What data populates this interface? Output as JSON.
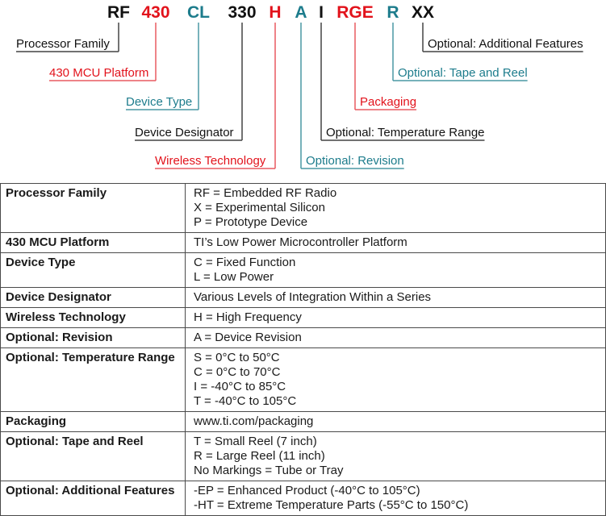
{
  "colors": {
    "black": "#111111",
    "red": "#e2121b",
    "teal": "#1d7c8c",
    "line_black": "#444444",
    "line_red": "#e85a60",
    "line_teal": "#4a98a4"
  },
  "diagram": {
    "codes": [
      {
        "text": "RF",
        "color": "black"
      },
      {
        "text": "430",
        "color": "red"
      },
      {
        "text": "CL",
        "color": "teal"
      },
      {
        "text": "330",
        "color": "black"
      },
      {
        "text": "H",
        "color": "red"
      },
      {
        "text": "A",
        "color": "teal"
      },
      {
        "text": "I",
        "color": "black"
      },
      {
        "text": "RGE",
        "color": "red"
      },
      {
        "text": "R",
        "color": "teal"
      },
      {
        "text": "XX",
        "color": "black"
      }
    ],
    "labels": [
      {
        "code_index": 0,
        "text": "Processor Family",
        "color": "black",
        "side": "left"
      },
      {
        "code_index": 1,
        "text": "430 MCU Platform",
        "color": "red",
        "side": "left"
      },
      {
        "code_index": 2,
        "text": "Device Type",
        "color": "teal",
        "side": "left"
      },
      {
        "code_index": 3,
        "text": "Device Designator",
        "color": "black",
        "side": "left"
      },
      {
        "code_index": 4,
        "text": "Wireless Technology",
        "color": "red",
        "side": "left"
      },
      {
        "code_index": 5,
        "text": "Optional: Revision",
        "color": "teal",
        "side": "right"
      },
      {
        "code_index": 6,
        "text": "Optional: Temperature Range",
        "color": "black",
        "side": "right"
      },
      {
        "code_index": 7,
        "text": "Packaging",
        "color": "red",
        "side": "right"
      },
      {
        "code_index": 8,
        "text": "Optional: Tape and Reel",
        "color": "teal",
        "side": "right"
      },
      {
        "code_index": 9,
        "text": "Optional: Additional Features",
        "color": "black",
        "side": "right"
      }
    ]
  },
  "table": {
    "rows": [
      {
        "field": "Processor Family",
        "values": [
          "RF = Embedded RF Radio",
          "X = Experimental Silicon",
          "P = Prototype Device"
        ]
      },
      {
        "field": "430 MCU Platform",
        "values": [
          "TI’s Low Power Microcontroller Platform"
        ]
      },
      {
        "field": "Device Type",
        "values": [
          "C = Fixed Function",
          "L = Low Power"
        ]
      },
      {
        "field": "Device Designator",
        "values": [
          "Various Levels of Integration Within a Series"
        ]
      },
      {
        "field": "Wireless Technology",
        "values": [
          "H = High Frequency"
        ]
      },
      {
        "field": "Optional: Revision",
        "values": [
          "A = Device Revision"
        ]
      },
      {
        "field": "Optional: Temperature Range",
        "values": [
          "S = 0°C to 50°C",
          "C = 0°C to 70°C",
          "I = -40°C to 85°C",
          "T = -40°C to 105°C"
        ]
      },
      {
        "field": "Packaging",
        "values": [
          "www.ti.com/packaging"
        ]
      },
      {
        "field": "Optional: Tape and Reel",
        "values": [
          "T = Small Reel (7 inch)",
          "R = Large Reel (11 inch)",
          "No Markings = Tube or Tray"
        ]
      },
      {
        "field": "Optional: Additional Features",
        "values": [
          "-EP = Enhanced Product (-40°C to 105°C)",
          "-HT = Extreme Temperature Parts (-55°C to 150°C)"
        ]
      }
    ]
  }
}
